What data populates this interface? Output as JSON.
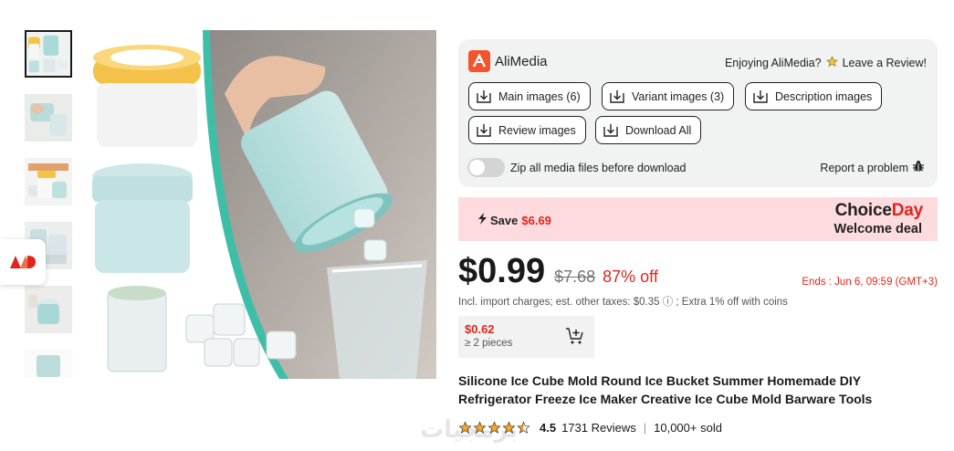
{
  "gallery": {
    "thumbnails": [
      {
        "name": "thumb-1",
        "active": true
      },
      {
        "name": "thumb-2",
        "active": false
      },
      {
        "name": "thumb-3",
        "active": false
      },
      {
        "name": "thumb-4",
        "active": false
      },
      {
        "name": "thumb-5",
        "active": false
      },
      {
        "name": "thumb-6",
        "active": false
      }
    ]
  },
  "alimedia": {
    "brand": "AliMedia",
    "enjoy_text": "Enjoying AliMedia?",
    "review_link": "Leave a Review!",
    "buttons": {
      "main_images": "Main images (6)",
      "variant_images": "Variant images (3)",
      "description_images": "Description images",
      "review_images": "Review images",
      "download_all": "Download All"
    },
    "zip_label": "Zip all media files before download",
    "zip_enabled": false,
    "report": "Report a problem"
  },
  "banner": {
    "save_label": "Save",
    "save_amount": "$6.69",
    "choice": "Choice",
    "day": "Day",
    "welcome": "Welcome deal"
  },
  "price": {
    "current": "$0.99",
    "original": "$7.68",
    "discount": "87% off",
    "ends": "Ends :  Jun 6, 09:59 (GMT+3)",
    "taxes": "Incl. import charges; est. other taxes: $0.35 ⓘ ; Extra 1% off with coins"
  },
  "bulk": {
    "price": "$0.62",
    "qty": "≥ 2 pieces"
  },
  "product": {
    "title": "Silicone Ice Cube Mold Round Ice Bucket Summer Homemade DIY Refrigerator Freeze Ice Maker Creative Ice Cube Mold Barware Tools"
  },
  "rating": {
    "score": "4.5",
    "reviews": "1731 Reviews",
    "sold": "10,000+ sold",
    "stars": 4.5
  },
  "watermark": "برمجيات",
  "colors": {
    "accent": "#e1251b",
    "alimedia_orange": "#f2552c",
    "banner_bg": "#fddbdf",
    "panel_bg": "#f1f2f2",
    "star": "#f5a623"
  }
}
